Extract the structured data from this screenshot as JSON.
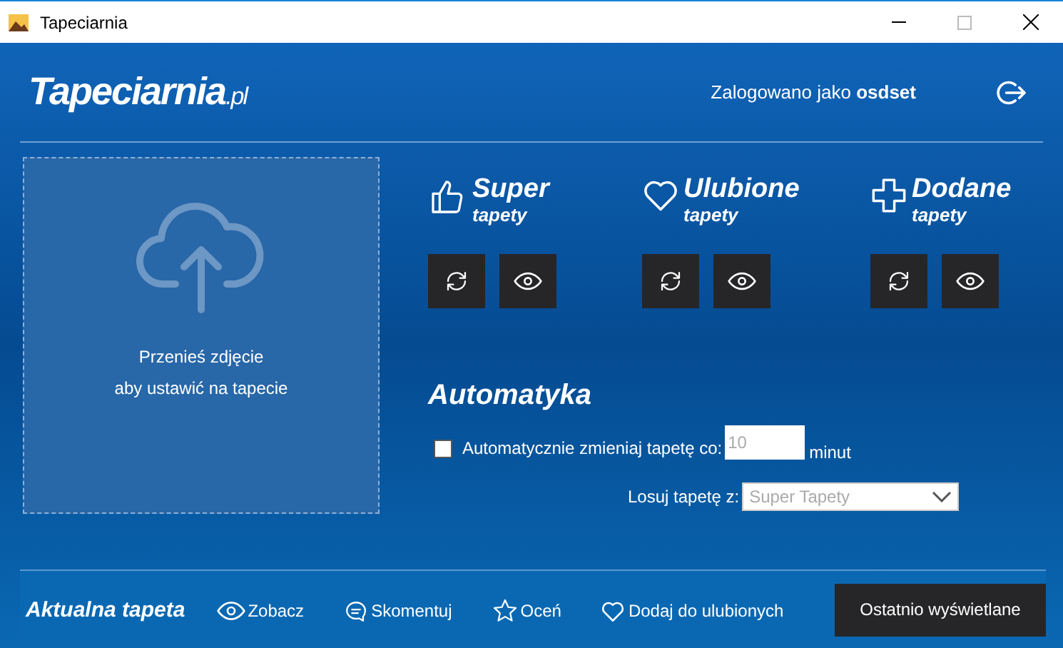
{
  "window": {
    "title": "Tapeciarnia"
  },
  "header": {
    "logo_main": "Tapeciarnia",
    "logo_suffix": ".pl",
    "login_label": "Zalogowano jako",
    "username": "osdset"
  },
  "upload": {
    "line_1": "Przenieś zdjęcie",
    "line_2": "aby ustawić na tapecie"
  },
  "categories": [
    {
      "kind": "like",
      "title": "Super",
      "subtitle": "tapety"
    },
    {
      "kind": "heart",
      "title": "Ulubione",
      "subtitle": "tapety"
    },
    {
      "kind": "plus",
      "title": "Dodane",
      "subtitle": "tapety"
    }
  ],
  "auto": {
    "heading": "Automatyka",
    "checkbox_label": "Automatycznie zmieniaj tapetę co:",
    "checked": false,
    "interval_placeholder": "10",
    "unit": "minut",
    "source_label": "Losuj tapetę z:",
    "source_value": "Super Tapety"
  },
  "bottom_bar": {
    "title": "Aktualna tapeta",
    "actions": [
      {
        "kind": "eye",
        "label": "Zobacz"
      },
      {
        "kind": "comment",
        "label": "Skomentuj"
      },
      {
        "kind": "star",
        "label": "Oceń"
      },
      {
        "kind": "heart",
        "label": "Dodaj do ulubionych"
      }
    ],
    "recent_button": "Ostatnio wyświetlane"
  }
}
